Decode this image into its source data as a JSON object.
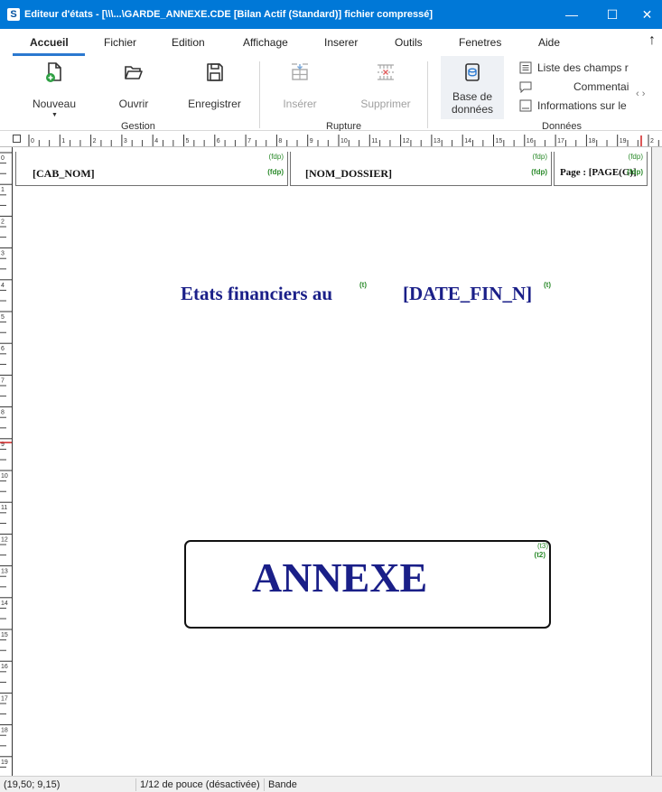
{
  "window": {
    "app_logo": "S",
    "title": "Editeur d'états - [\\\\\\...\\GARDE_ANNEXE.CDE [Bilan Actif (Standard)] fichier compressé]",
    "minimize_glyph": "—",
    "maximize_glyph": "☐",
    "close_glyph": "✕"
  },
  "tabs": [
    {
      "label": "Accueil",
      "active": true
    },
    {
      "label": "Fichier"
    },
    {
      "label": "Edition"
    },
    {
      "label": "Affichage"
    },
    {
      "label": "Inserer"
    },
    {
      "label": "Outils"
    },
    {
      "label": "Fenetres"
    },
    {
      "label": "Aide"
    }
  ],
  "ribbon_collapse_glyph": "↑",
  "ribbon": {
    "nouveau": "Nouveau",
    "ouvrir": "Ouvrir",
    "enregistrer": "Enregistrer",
    "inserer": "Insérer",
    "supprimer": "Supprimer",
    "base_line1": "Base de",
    "base_line2": "données",
    "liste_champs": "Liste des champs r",
    "commentaire": "Commentai",
    "informations": "Informations sur le",
    "scroll_glyph": "‹ ›",
    "groups": {
      "gestion": "Gestion",
      "rupture": "Rupture",
      "donnees": "Données"
    }
  },
  "ruler": {
    "h_labels": [
      "0",
      "1",
      "2",
      "3",
      "4",
      "5",
      "6",
      "7",
      "8",
      "9",
      "10",
      "11",
      "12",
      "13",
      "14",
      "15",
      "16",
      "17",
      "18",
      "19",
      "2"
    ],
    "v_labels": [
      "0",
      "1",
      "2",
      "3",
      "4",
      "5",
      "6",
      "7",
      "8",
      "9",
      "10",
      "11",
      "12",
      "13",
      "14",
      "15",
      "16",
      "17",
      "18",
      "19"
    ]
  },
  "report": {
    "header_fields": [
      {
        "text": "[CAB_NOM]",
        "tag_top": "(fdp)",
        "tag_bottom": "(fdp)"
      },
      {
        "text": "[NOM_DOSSIER]",
        "tag_top": "(fdp)",
        "tag_bottom": "(fdp)"
      },
      {
        "text": "Page : [PAGE(G)]",
        "tag_top": "(fdp)",
        "tag_bottom": "(fdp)"
      }
    ],
    "title_left": "Etats financiers au",
    "title_left_tag": "(t)",
    "title_right": "[DATE_FIN_N]",
    "title_right_tag": "(t)",
    "annex_text": "ANNEXE",
    "annex_tag1": "(t3)",
    "annex_tag2": "(t2)"
  },
  "status": {
    "coords": "(19,50; 9,15)",
    "grid": "1/12 de pouce (désactivée)",
    "mode": "Bande"
  },
  "colors": {
    "titlebar": "#0078d7",
    "report_blue": "#1a1f88",
    "tag_green": "#2a8a2a",
    "tab_underline": "#2b79d0"
  }
}
